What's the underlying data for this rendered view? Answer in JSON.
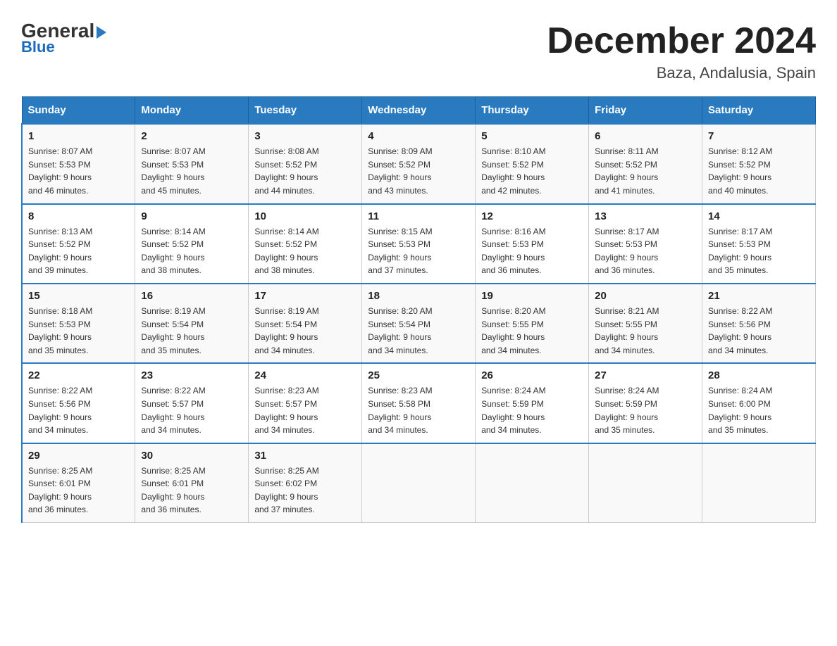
{
  "header": {
    "logo_top": "General",
    "logo_bottom": "Blue",
    "main_title": "December 2024",
    "subtitle": "Baza, Andalusia, Spain"
  },
  "days_of_week": [
    "Sunday",
    "Monday",
    "Tuesday",
    "Wednesday",
    "Thursday",
    "Friday",
    "Saturday"
  ],
  "weeks": [
    [
      {
        "day": "1",
        "sunrise": "8:07 AM",
        "sunset": "5:53 PM",
        "daylight": "9 hours and 46 minutes."
      },
      {
        "day": "2",
        "sunrise": "8:07 AM",
        "sunset": "5:53 PM",
        "daylight": "9 hours and 45 minutes."
      },
      {
        "day": "3",
        "sunrise": "8:08 AM",
        "sunset": "5:52 PM",
        "daylight": "9 hours and 44 minutes."
      },
      {
        "day": "4",
        "sunrise": "8:09 AM",
        "sunset": "5:52 PM",
        "daylight": "9 hours and 43 minutes."
      },
      {
        "day": "5",
        "sunrise": "8:10 AM",
        "sunset": "5:52 PM",
        "daylight": "9 hours and 42 minutes."
      },
      {
        "day": "6",
        "sunrise": "8:11 AM",
        "sunset": "5:52 PM",
        "daylight": "9 hours and 41 minutes."
      },
      {
        "day": "7",
        "sunrise": "8:12 AM",
        "sunset": "5:52 PM",
        "daylight": "9 hours and 40 minutes."
      }
    ],
    [
      {
        "day": "8",
        "sunrise": "8:13 AM",
        "sunset": "5:52 PM",
        "daylight": "9 hours and 39 minutes."
      },
      {
        "day": "9",
        "sunrise": "8:14 AM",
        "sunset": "5:52 PM",
        "daylight": "9 hours and 38 minutes."
      },
      {
        "day": "10",
        "sunrise": "8:14 AM",
        "sunset": "5:52 PM",
        "daylight": "9 hours and 38 minutes."
      },
      {
        "day": "11",
        "sunrise": "8:15 AM",
        "sunset": "5:53 PM",
        "daylight": "9 hours and 37 minutes."
      },
      {
        "day": "12",
        "sunrise": "8:16 AM",
        "sunset": "5:53 PM",
        "daylight": "9 hours and 36 minutes."
      },
      {
        "day": "13",
        "sunrise": "8:17 AM",
        "sunset": "5:53 PM",
        "daylight": "9 hours and 36 minutes."
      },
      {
        "day": "14",
        "sunrise": "8:17 AM",
        "sunset": "5:53 PM",
        "daylight": "9 hours and 35 minutes."
      }
    ],
    [
      {
        "day": "15",
        "sunrise": "8:18 AM",
        "sunset": "5:53 PM",
        "daylight": "9 hours and 35 minutes."
      },
      {
        "day": "16",
        "sunrise": "8:19 AM",
        "sunset": "5:54 PM",
        "daylight": "9 hours and 35 minutes."
      },
      {
        "day": "17",
        "sunrise": "8:19 AM",
        "sunset": "5:54 PM",
        "daylight": "9 hours and 34 minutes."
      },
      {
        "day": "18",
        "sunrise": "8:20 AM",
        "sunset": "5:54 PM",
        "daylight": "9 hours and 34 minutes."
      },
      {
        "day": "19",
        "sunrise": "8:20 AM",
        "sunset": "5:55 PM",
        "daylight": "9 hours and 34 minutes."
      },
      {
        "day": "20",
        "sunrise": "8:21 AM",
        "sunset": "5:55 PM",
        "daylight": "9 hours and 34 minutes."
      },
      {
        "day": "21",
        "sunrise": "8:22 AM",
        "sunset": "5:56 PM",
        "daylight": "9 hours and 34 minutes."
      }
    ],
    [
      {
        "day": "22",
        "sunrise": "8:22 AM",
        "sunset": "5:56 PM",
        "daylight": "9 hours and 34 minutes."
      },
      {
        "day": "23",
        "sunrise": "8:22 AM",
        "sunset": "5:57 PM",
        "daylight": "9 hours and 34 minutes."
      },
      {
        "day": "24",
        "sunrise": "8:23 AM",
        "sunset": "5:57 PM",
        "daylight": "9 hours and 34 minutes."
      },
      {
        "day": "25",
        "sunrise": "8:23 AM",
        "sunset": "5:58 PM",
        "daylight": "9 hours and 34 minutes."
      },
      {
        "day": "26",
        "sunrise": "8:24 AM",
        "sunset": "5:59 PM",
        "daylight": "9 hours and 34 minutes."
      },
      {
        "day": "27",
        "sunrise": "8:24 AM",
        "sunset": "5:59 PM",
        "daylight": "9 hours and 35 minutes."
      },
      {
        "day": "28",
        "sunrise": "8:24 AM",
        "sunset": "6:00 PM",
        "daylight": "9 hours and 35 minutes."
      }
    ],
    [
      {
        "day": "29",
        "sunrise": "8:25 AM",
        "sunset": "6:01 PM",
        "daylight": "9 hours and 36 minutes."
      },
      {
        "day": "30",
        "sunrise": "8:25 AM",
        "sunset": "6:01 PM",
        "daylight": "9 hours and 36 minutes."
      },
      {
        "day": "31",
        "sunrise": "8:25 AM",
        "sunset": "6:02 PM",
        "daylight": "9 hours and 37 minutes."
      },
      null,
      null,
      null,
      null
    ]
  ],
  "labels": {
    "sunrise_label": "Sunrise:",
    "sunset_label": "Sunset:",
    "daylight_label": "Daylight:"
  }
}
